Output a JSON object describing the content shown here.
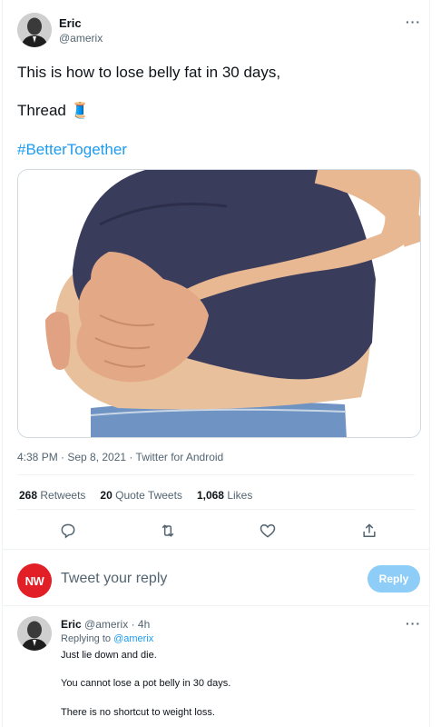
{
  "tweet": {
    "author_name": "Eric",
    "author_handle": "@amerix",
    "more_glyph": "···",
    "line1": "This is how to lose belly fat in 30 days,",
    "line2": "Thread",
    "line2_emoji": "🧵",
    "hashtag": "#BetterTogether",
    "meta": "4:38 PM · Sep 8, 2021 · Twitter for Android",
    "stats": {
      "retweets_count": "268",
      "retweets_label": "Retweets",
      "quotes_count": "20",
      "quotes_label": "Quote Tweets",
      "likes_count": "1,068",
      "likes_label": "Likes"
    },
    "actions": [
      "reply-icon",
      "retweet-icon",
      "like-icon",
      "share-icon"
    ]
  },
  "compose": {
    "logo_text": "NW",
    "placeholder": "Tweet your reply",
    "button_label": "Reply",
    "button_color": "#8ecdf8"
  },
  "reply": {
    "author_name": "Eric",
    "author_handle": "@amerix",
    "time": "· 4h",
    "more_glyph": "···",
    "replying_prefix": "Replying to",
    "replying_to": "@amerix",
    "paragraphs": [
      "Just lie down and die.",
      "You cannot lose a pot belly in 30 days.",
      "There is no shortcut to weight loss."
    ]
  },
  "colors": {
    "link": "#1d9bf0",
    "secondary_text": "#536471",
    "logo_red": "#e21e26"
  }
}
